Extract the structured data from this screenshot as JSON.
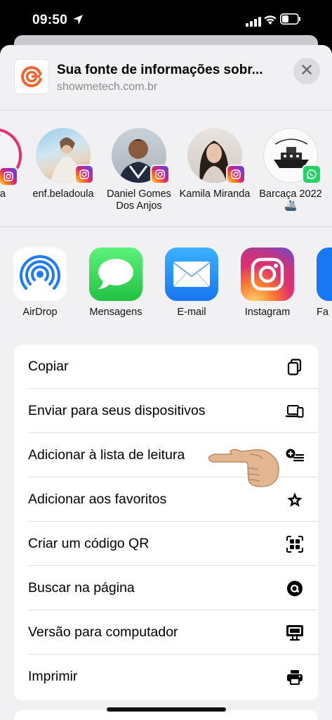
{
  "status": {
    "time": "09:50"
  },
  "header": {
    "title": "Sua fonte de informações sobr...",
    "url": "showmetech.com.br",
    "close_icon": "xmark-icon"
  },
  "people": [
    {
      "name": "ra",
      "badge": "instagram"
    },
    {
      "name": "enf.beladoula",
      "badge": "instagram"
    },
    {
      "name": "Daniel Gomes Dos Anjos",
      "badge": "instagram"
    },
    {
      "name": "Kamila Miranda",
      "badge": "instagram"
    },
    {
      "name": "Barcaça 2022 🚢",
      "badge": "whatsapp"
    }
  ],
  "apps": [
    {
      "label": "AirDrop",
      "icon": "airdrop-icon"
    },
    {
      "label": "Mensagens",
      "icon": "messages-icon"
    },
    {
      "label": "E-mail",
      "icon": "mail-icon"
    },
    {
      "label": "Instagram",
      "icon": "instagram-icon"
    },
    {
      "label": "Fa",
      "icon": "facebook-icon"
    }
  ],
  "actions": [
    {
      "label": "Copiar",
      "icon": "copy-icon"
    },
    {
      "label": "Enviar para seus dispositivos",
      "icon": "devices-icon"
    },
    {
      "label": "Adicionar à lista de leitura",
      "icon": "reading-list-icon"
    },
    {
      "label": "Adicionar aos favoritos",
      "icon": "star-icon"
    },
    {
      "label": "Criar um código QR",
      "icon": "qr-code-icon"
    },
    {
      "label": "Buscar na página",
      "icon": "find-on-page-icon"
    },
    {
      "label": "Versão para computador",
      "icon": "desktop-icon"
    },
    {
      "label": "Imprimir",
      "icon": "printer-icon"
    }
  ],
  "colors": {
    "sheet_bg": "#f1f1f4",
    "messages_green": "#34c759",
    "mail_blue": "#1a8cff",
    "airdrop_blue": "#1e7cf2",
    "whatsapp_green": "#25d366"
  }
}
